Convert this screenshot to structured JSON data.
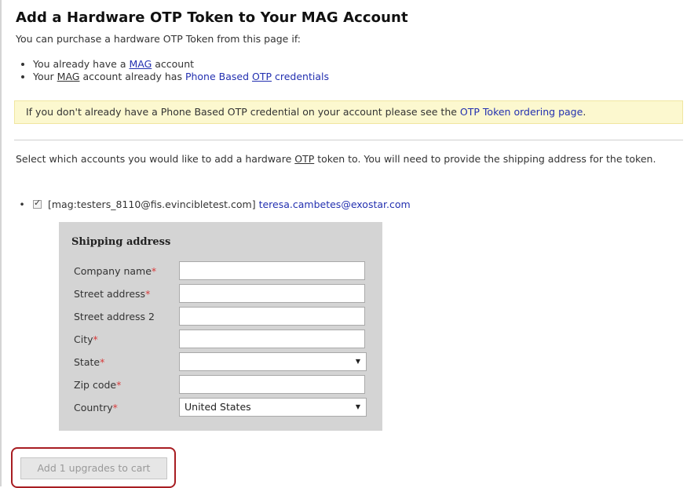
{
  "page": {
    "title": "Add a Hardware OTP Token to Your MAG Account",
    "intro": "You can purchase a hardware OTP Token from this page if:",
    "requirements": {
      "item1_prefix": "You already have a ",
      "item1_link": "MAG",
      "item1_suffix": " account",
      "item2_prefix": "Your ",
      "item2_abbr": "MAG",
      "item2_mid": " account already has ",
      "item2_link1": "Phone Based ",
      "item2_link2": "OTP",
      "item2_link3": " credentials"
    },
    "notice": {
      "text": "If you don't already have a Phone Based OTP credential on your account please see the ",
      "link": "OTP Token ordering page",
      "suffix": "."
    },
    "select_text": {
      "prefix": "Select which accounts you would like to add a hardware ",
      "abbr": "OTP",
      "suffix": " token to. You will need to provide the shipping address for the token."
    },
    "account": {
      "checked": true,
      "id": "[mag:testers_8110@fis.evincibletest.com]",
      "email": "teresa.cambetes@exostar.com"
    },
    "shipping": {
      "title": "Shipping address",
      "fields": {
        "company": {
          "label": "Company name",
          "required": "*",
          "value": ""
        },
        "street": {
          "label": "Street address",
          "required": "*",
          "value": ""
        },
        "street2": {
          "label": "Street address 2",
          "required": "",
          "value": ""
        },
        "city": {
          "label": "City",
          "required": "*",
          "value": ""
        },
        "state": {
          "label": "State",
          "required": "*",
          "value": ""
        },
        "zip": {
          "label": "Zip code",
          "required": "*",
          "value": ""
        },
        "country": {
          "label": "Country",
          "required": "*",
          "value": "United States"
        }
      }
    },
    "cart_button": "Add 1 upgrades to cart",
    "colors": {
      "link": "#2330b0",
      "notice_bg": "#fcf8cf",
      "highlight_border": "#a81d22",
      "required": "#d83a3a"
    }
  }
}
